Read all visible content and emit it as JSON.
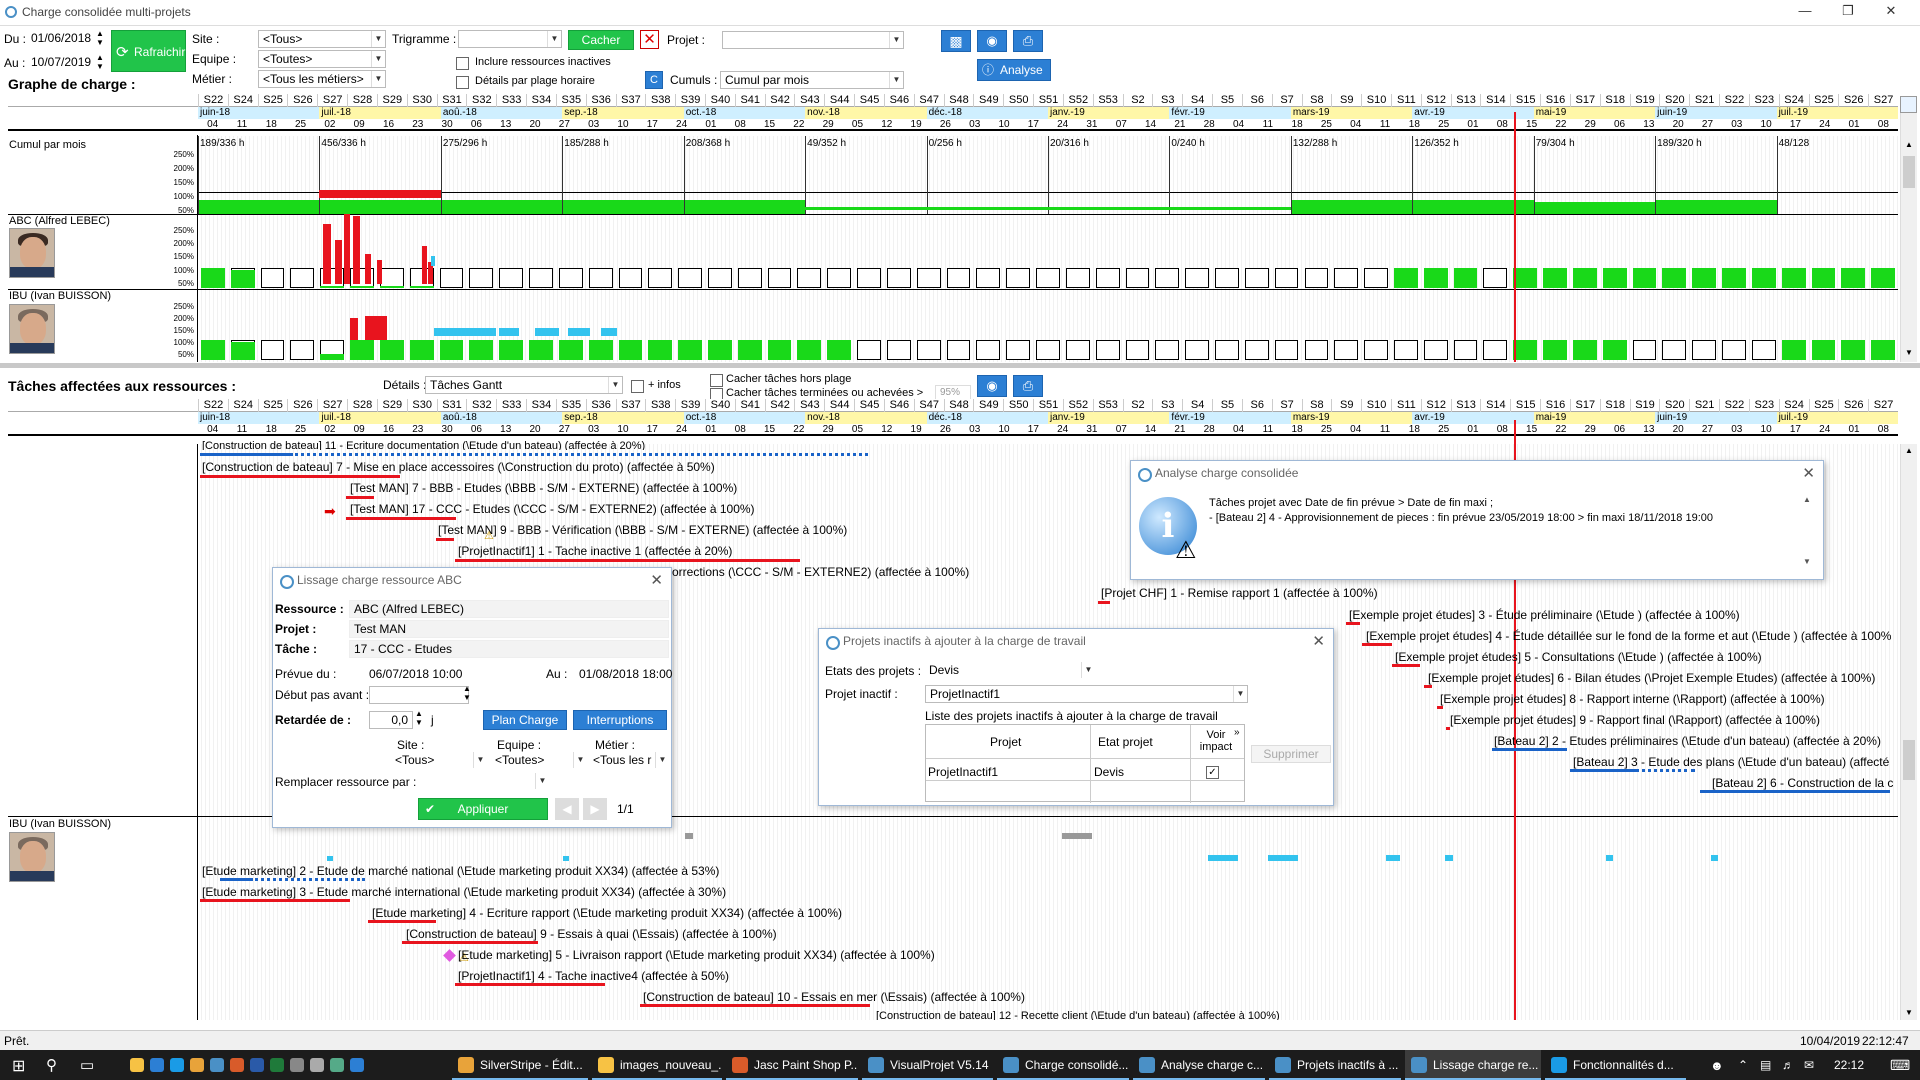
{
  "window": {
    "title": "Charge consolidée multi-projets"
  },
  "filters": {
    "du_label": "Du :",
    "du_value": "01/06/2018",
    "au_label": "Au :",
    "au_value": "10/07/2019",
    "refresh_label": "Rafraichir",
    "site_label": "Site :",
    "site_value": "<Tous>",
    "equipe_label": "Equipe :",
    "equipe_value": "<Toutes>",
    "metier_label": "Métier :",
    "metier_value": "<Tous les métiers>",
    "trigramme_label": "Trigramme :",
    "trigramme_value": "",
    "cacher_label": "Cacher",
    "projet_label": "Projet :",
    "projet_value": "",
    "inclure_label": "Inclure ressources inactives",
    "details_label": "Détails par plage horaire",
    "cumuls_label": "Cumuls :",
    "cumuls_value": "Cumul par mois",
    "analyse_label": "Analyse"
  },
  "graph_section": {
    "title": "Graphe de charge :"
  },
  "weeks": [
    "S22",
    "S24",
    "S25",
    "S26",
    "S27",
    "S28",
    "S29",
    "S30",
    "S31",
    "S32",
    "S33",
    "S34",
    "S35",
    "S36",
    "S37",
    "S38",
    "S39",
    "S40",
    "S41",
    "S42",
    "S43",
    "S44",
    "S45",
    "S46",
    "S47",
    "S48",
    "S49",
    "S50",
    "S51",
    "S52",
    "S53",
    "S2",
    "S3",
    "S4",
    "S5",
    "S6",
    "S7",
    "S8",
    "S9",
    "S10",
    "S11",
    "S12",
    "S13",
    "S14",
    "S15",
    "S16",
    "S17",
    "S18",
    "S19",
    "S20",
    "S21",
    "S22",
    "S23",
    "S24",
    "S25",
    "S26",
    "S27"
  ],
  "months": [
    {
      "label": "juin-18",
      "color": "#cfefff"
    },
    {
      "label": "juil.-18",
      "color": "#fff7a8"
    },
    {
      "label": "aoû.-18",
      "color": "#cfefff"
    },
    {
      "label": "sep.-18",
      "color": "#fff7a8"
    },
    {
      "label": "oct.-18",
      "color": "#cfefff"
    },
    {
      "label": "nov.-18",
      "color": "#fff7a8"
    },
    {
      "label": "déc.-18",
      "color": "#cfefff"
    },
    {
      "label": "janv.-19",
      "color": "#fff7a8"
    },
    {
      "label": "févr.-19",
      "color": "#cfefff"
    },
    {
      "label": "mars-19",
      "color": "#fff7a8"
    },
    {
      "label": "avr.-19",
      "color": "#cfefff"
    },
    {
      "label": "mai-19",
      "color": "#fff7a8"
    },
    {
      "label": "juin-19",
      "color": "#cfefff"
    },
    {
      "label": "juil.-19",
      "color": "#fff7a8"
    }
  ],
  "days": [
    "04",
    "11",
    "18",
    "25",
    "02",
    "09",
    "16",
    "23",
    "30",
    "06",
    "13",
    "20",
    "27",
    "03",
    "10",
    "17",
    "24",
    "01",
    "08",
    "15",
    "22",
    "29",
    "05",
    "12",
    "19",
    "26",
    "03",
    "10",
    "17",
    "24",
    "31",
    "07",
    "14",
    "21",
    "28",
    "04",
    "11",
    "18",
    "25",
    "04",
    "11",
    "18",
    "25",
    "01",
    "08",
    "15",
    "22",
    "29",
    "06",
    "13",
    "20",
    "27",
    "03",
    "10",
    "17",
    "24",
    "01",
    "08"
  ],
  "graph_rows": [
    {
      "name": "Cumul par mois",
      "monthly": [
        "189/336 h",
        "456/336 h",
        "275/296 h",
        "185/288 h",
        "208/368 h",
        "49/352 h",
        "0/256 h",
        "20/316 h",
        "0/240 h",
        "132/288 h",
        "126/352 h",
        "79/304 h",
        "189/320 h",
        "48/128"
      ]
    },
    {
      "name": "ABC (Alfred LEBEC)"
    },
    {
      "name": "IBU (Ivan BUISSON)"
    }
  ],
  "pct_labels": [
    "250%",
    "200%",
    "150%",
    "100%",
    "50%"
  ],
  "tasks_section": {
    "title": "Tâches affectées aux ressources :",
    "details_label": "Détails :",
    "details_value": "Tâches Gantt",
    "infos_label": "+ infos",
    "hide_out_label": "Cacher tâches hors plage",
    "hide_done_label": "Cacher tâches terminées ou achevées >",
    "hide_done_value": "95%"
  },
  "abc_tasks": [
    "[Construction de bateau] 11 - Ecriture documentation (\\Etude d'un bateau) (affectée à 20%)",
    "[Construction de bateau] 7 - Mise en place accessoires (\\Construction du proto) (affectée à 50%)",
    "[Test MAN] 7 - BBB - Etudes (\\BBB - S/M - EXTERNE) (affectée à 100%)",
    "[Test MAN] 17 - CCC - Etudes (\\CCC - S/M - EXTERNE2) (affectée à 100%)",
    "[Test MAN] 9 - BBB - Vérification (\\BBB - S/M - EXTERNE) (affectée à 100%)",
    "[ProjetInactif1] 1 - Tache inactive 1 (affectée à 20%)",
    "orrections (\\CCC - S/M - EXTERNE2) (affectée à 100%)",
    "[Projet CHF] 1 - Remise rapport 1 (affectée à 100%)",
    "[Exemple projet études] 3 - Étude préliminaire (\\Etude ) (affectée à 100%)",
    "[Exemple projet études] 4 - Étude détaillée sur le fond de la forme et aut (\\Etude ) (affectée à 100%",
    "[Exemple projet études] 5 - Consultations (\\Etude ) (affectée à 100%)",
    "[Exemple projet études] 6 - Bilan études (\\Projet Exemple Etudes) (affectée à 100%)",
    "[Exemple projet études] 8 - Rapport interne (\\Rapport) (affectée à 100%)",
    "[Exemple projet études] 9 - Rapport final (\\Rapport) (affectée à 100%)",
    "[Bateau 2] 2 - Etudes préliminaires  (\\Etude d'un bateau) (affectée à 20%)",
    "[Bateau 2] 3 - Etude des plans (\\Etude d'un bateau) (affecté",
    "[Bateau 2] 6 - Construction de la c"
  ],
  "ibu_label": "IBU (Ivan BUISSON)",
  "ibu_tasks": [
    "[Etude marketing] 2 - Etude de marché national (\\Etude marketing produit XX34) (affectée à 53%)",
    "[Etude marketing] 3 - Etude marché international (\\Etude marketing produit XX34) (affectée à 30%)",
    "[Etude marketing] 4 - Ecriture rapport (\\Etude marketing produit XX34) (affectée à 100%)",
    "[Construction de bateau] 9 - Essais à quai (\\Essais) (affectée à 100%)",
    "[Etude marketing] 5 - Livraison rapport (\\Etude marketing produit XX34) (affectée à 100%)",
    "[ProjetInactif1] 4 - Tache inactive4 (affectée à 50%)",
    "[Construction de bateau] 10 - Essais en mer (\\Essais) (affectée à 100%)",
    "[Construction de bateau] 12 - Recette client (\\Etude d'un bateau) (affectée à 100%)"
  ],
  "dlg_lissage": {
    "title": "Lissage charge ressource ABC",
    "ressource_label": "Ressource :",
    "ressource_value": "ABC (Alfred LEBEC)",
    "projet_label": "Projet :",
    "projet_value": "Test MAN",
    "tache_label": "Tâche :",
    "tache_value": "17 - CCC - Etudes",
    "prevue_label": "Prévue du :",
    "prevue_value": "06/07/2018 10:00",
    "au_label": "Au :",
    "au_value": "01/08/2018 18:00",
    "debut_label": "Début pas avant :",
    "retard_label": "Retardée de :",
    "retard_value": "0,0",
    "retard_unit": "j",
    "plan_label": "Plan Charge",
    "interruptions_label": "Interruptions",
    "site_label": "Site :",
    "site_value": "<Tous>",
    "equipe_label": "Equipe :",
    "equipe_value": "<Toutes>",
    "metier_label": "Métier :",
    "metier_value": "<Tous les r",
    "remplacer_label": "Remplacer ressource par :",
    "appliquer_label": "Appliquer",
    "page_label": "1/1"
  },
  "dlg_inactifs": {
    "title": "Projets inactifs à ajouter à la charge de travail",
    "etats_label": "Etats des projets :",
    "etats_value": "Devis",
    "projet_label": "Projet inactif :",
    "projet_value": "ProjetInactif1",
    "list_title": "Liste des projets inactifs à ajouter à la charge de travail",
    "col_projet": "Projet",
    "col_etat": "Etat projet",
    "col_voir": "Voir impact",
    "row_projet": "ProjetInactif1",
    "row_etat": "Devis",
    "supprimer_label": "Supprimer"
  },
  "dlg_analyse": {
    "title": "Analyse charge consolidée",
    "line1": "Tâches projet avec Date de fin prévue > Date de fin maxi ;",
    "line2": "- [Bateau 2] 4 - Approvisionnement de pieces : fin prévue 23/05/2019 18:00 > fin maxi 18/11/2018 19:00"
  },
  "status": {
    "left": "Prêt.",
    "date": "10/04/2019",
    "time": "22:12:47"
  },
  "taskbar": {
    "items": [
      "SilverStripe - Édit...",
      "images_nouveau_...",
      "Jasc Paint Shop P...",
      "VisualProjet V5.14",
      "Charge consolidé...",
      "Analyse charge c...",
      "Projets inactifs à ...",
      "Lissage charge re...",
      "Fonctionnalités d..."
    ],
    "clock": "22:12",
    "date": "10/04/2019"
  },
  "colors": {
    "green": "#19d919",
    "red": "#e8141e",
    "blue": "#1a63c8",
    "cyan": "#33c3ee",
    "today": "#e8141e"
  }
}
